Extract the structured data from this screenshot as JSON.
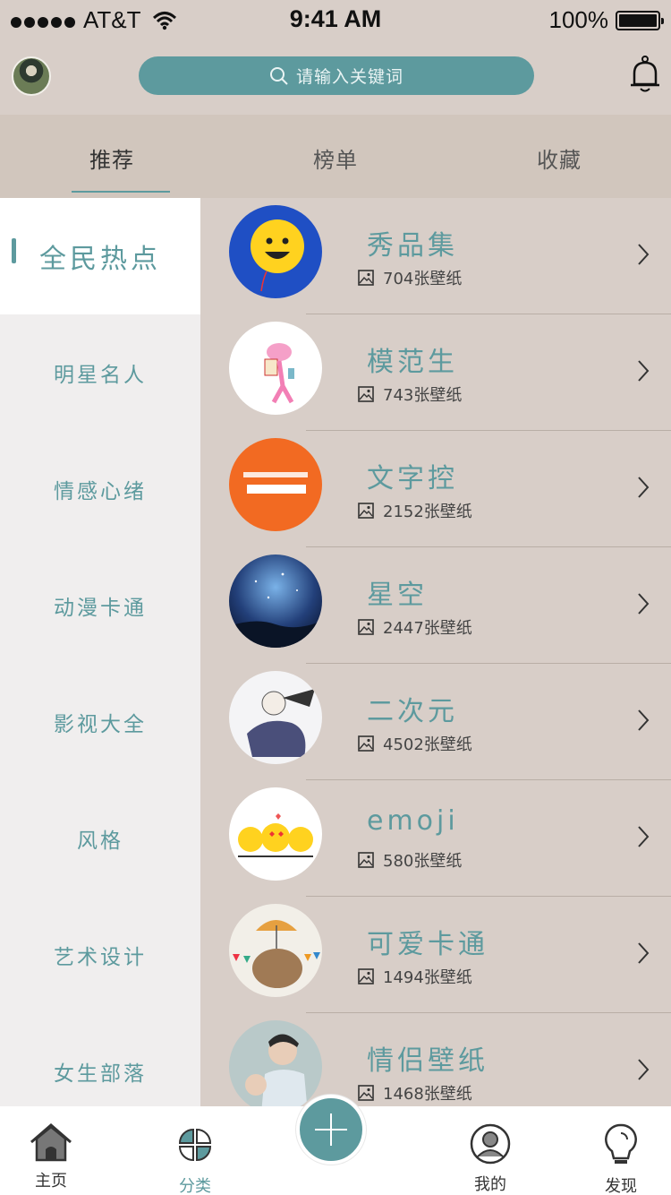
{
  "status_bar": {
    "carrier": "AT&T",
    "time": "9:41 AM",
    "battery": "100%"
  },
  "header": {
    "search_placeholder": "请输入关键词"
  },
  "tabs": [
    {
      "label": "推荐",
      "active": true
    },
    {
      "label": "榜单",
      "active": false
    },
    {
      "label": "收藏",
      "active": false
    }
  ],
  "sidebar": {
    "items": [
      {
        "label": "全民热点",
        "active": true
      },
      {
        "label": "明星名人"
      },
      {
        "label": "情感心绪"
      },
      {
        "label": "动漫卡通"
      },
      {
        "label": "影视大全"
      },
      {
        "label": "风格"
      },
      {
        "label": "艺术设计"
      },
      {
        "label": "女生部落"
      }
    ]
  },
  "list": {
    "items": [
      {
        "title": "秀品集",
        "count": "704张壁纸"
      },
      {
        "title": "模范生",
        "count": "743张壁纸"
      },
      {
        "title": "文字控",
        "count": "2152张壁纸"
      },
      {
        "title": "星空",
        "count": "2447张壁纸"
      },
      {
        "title": "二次元",
        "count": "4502张壁纸"
      },
      {
        "title": "emoji",
        "count": "580张壁纸"
      },
      {
        "title": "可爱卡通",
        "count": "1494张壁纸"
      },
      {
        "title": "情侣壁纸",
        "count": "1468张壁纸"
      }
    ]
  },
  "bottom_nav": {
    "items": [
      {
        "label": "主页",
        "icon": "home-icon"
      },
      {
        "label": "分类",
        "icon": "category-icon",
        "active": true
      },
      {
        "label": "我的",
        "icon": "profile-icon"
      },
      {
        "label": "发现",
        "icon": "discover-bulb-icon"
      }
    ],
    "center_button": "plus-icon"
  },
  "colors": {
    "accent": "#5d9a9e",
    "background": "#d8cec8",
    "sidebar": "#f0eeee"
  }
}
